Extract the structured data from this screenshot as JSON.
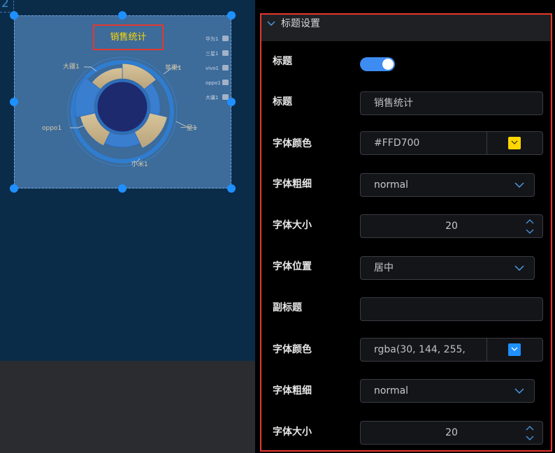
{
  "canvas": {
    "index_label": "2",
    "chart_title": "销售统计",
    "chart_data": {
      "type": "pie",
      "title": "销售统计",
      "categories": [
        "华为1",
        "三星1",
        "vivo1",
        "oppo1",
        "大疆1",
        "小米1",
        "苹果1"
      ],
      "legend": [
        "华为1",
        "三星1",
        "vivo1",
        "oppo1",
        "大疆1"
      ],
      "slice_labels": [
        "大疆1",
        "苹果1",
        "oppo1",
        "一星1",
        "小米1"
      ],
      "legend_position": "right"
    }
  },
  "panel": {
    "section_title": "标题设置",
    "rows": {
      "show_title_label": "标题",
      "show_title_value": true,
      "title_label": "标题",
      "title_value": "销售统计",
      "font_color_label": "字体颜色",
      "font_color_value": "#FFD700",
      "font_weight_label": "字体粗细",
      "font_weight_value": "normal",
      "font_size_label": "字体大小",
      "font_size_value": "20",
      "position_label": "字体位置",
      "position_value": "居中",
      "subtitle_label": "副标题",
      "subtitle_value": "",
      "sub_font_color_label": "字体颜色",
      "sub_font_color_value": "rgba(30, 144, 255,",
      "sub_font_weight_label": "字体粗细",
      "sub_font_weight_value": "normal",
      "sub_font_size_label": "字体大小",
      "sub_font_size_value": "20"
    }
  },
  "colors": {
    "accent": "#1e90ff",
    "highlight_border": "#e5382e",
    "title_color": "#ffd700",
    "sub_swatch": "#1e90ff"
  }
}
